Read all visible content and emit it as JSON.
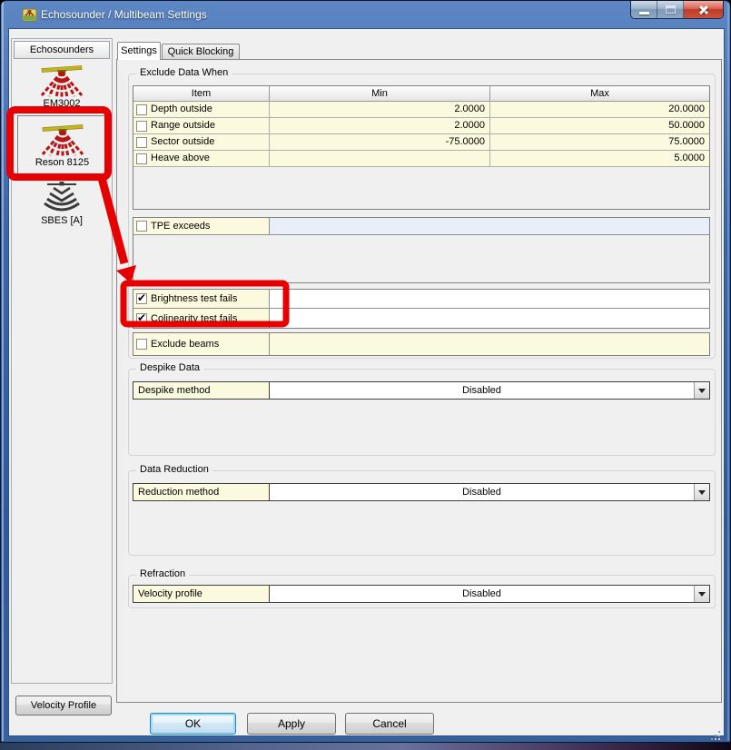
{
  "window": {
    "title": "Echosounder / Multibeam Settings"
  },
  "sidebar": {
    "header": "Echosounders",
    "items": [
      {
        "label": "EM3002",
        "selected": false
      },
      {
        "label": "Reson 8125",
        "selected": true
      },
      {
        "label": "SBES [A]",
        "selected": false
      }
    ],
    "velocity_profile_button": "Velocity Profile"
  },
  "tabs": [
    {
      "label": "Settings",
      "active": true
    },
    {
      "label": "Quick Blocking",
      "active": false
    }
  ],
  "exclude_group": {
    "title": "Exclude Data When",
    "table": {
      "headers": [
        "Item",
        "Min",
        "Max"
      ],
      "rows": [
        {
          "item": "Depth outside",
          "checked": false,
          "min": "2.0000",
          "max": "20.0000"
        },
        {
          "item": "Range outside",
          "checked": false,
          "min": "2.0000",
          "max": "50.0000"
        },
        {
          "item": "Sector outside",
          "checked": false,
          "min": "-75.0000",
          "max": "75.0000"
        },
        {
          "item": "Heave above",
          "checked": false,
          "min": "",
          "max": "5.0000"
        }
      ]
    },
    "tpe_row": {
      "label": "TPE exceeds",
      "checked": false,
      "value": ""
    },
    "test_rows": [
      {
        "label": "Brightness test fails",
        "checked": true
      },
      {
        "label": "Colinearity test fails",
        "checked": true
      }
    ],
    "exclude_beams_row": {
      "label": "Exclude beams",
      "checked": false
    }
  },
  "despike_group": {
    "title": "Despike Data",
    "label": "Despike method",
    "value": "Disabled"
  },
  "reduction_group": {
    "title": "Data Reduction",
    "label": "Reduction method",
    "value": "Disabled"
  },
  "refraction_group": {
    "title": "Refraction",
    "label": "Velocity profile",
    "value": "Disabled"
  },
  "footer": {
    "ok": "OK",
    "apply": "Apply",
    "cancel": "Cancel"
  },
  "colors": {
    "annotation": "#e60000",
    "row_yellow": "#fbfade",
    "tpe_value": "#e9eff8",
    "titlebar": "#315fa8"
  }
}
